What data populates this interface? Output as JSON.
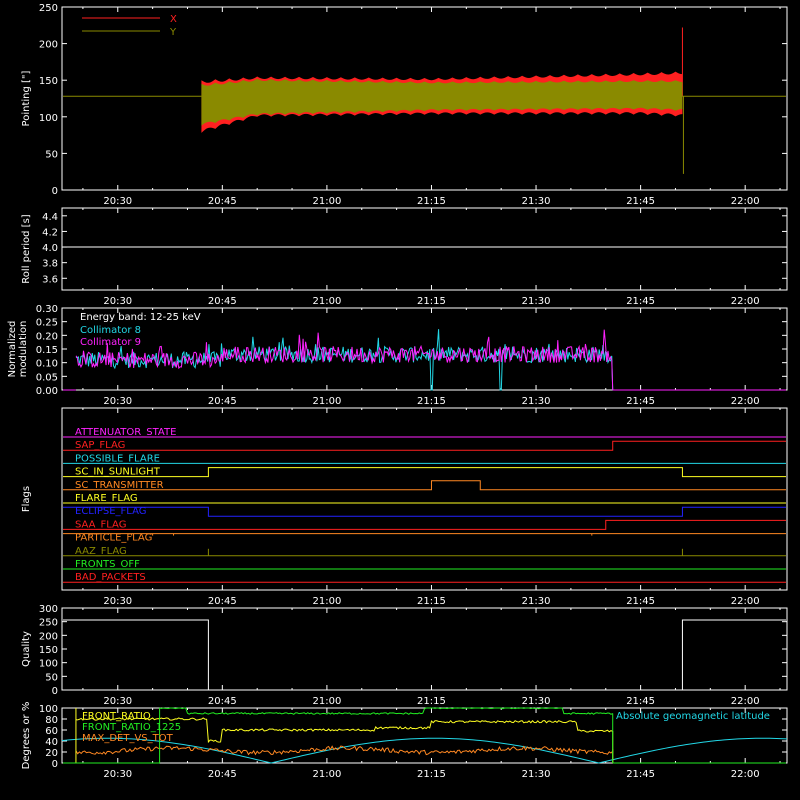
{
  "time_axis": {
    "start": "20:22",
    "end": "22:06",
    "ticks": [
      "20:30",
      "20:45",
      "21:00",
      "21:15",
      "21:30",
      "21:45",
      "22:00"
    ]
  },
  "colors": {
    "axis": "#ffffff",
    "x": "#ff2020",
    "y": "#8a8a00",
    "white": "#ffffff",
    "cyan": "#22d7e6",
    "magenta": "#ff22ff",
    "green": "#22ee22",
    "yellow": "#ffff22",
    "orange": "#ff8822"
  },
  "chart_data": [
    {
      "id": "pointing",
      "type": "line",
      "ylabel": "Pointing [\"]",
      "ylim": [
        0,
        250
      ],
      "yticks": [
        0,
        50,
        100,
        150,
        200,
        250
      ],
      "legend": {
        "position": "top-left",
        "entries": [
          {
            "label": "X",
            "color": "#ff2020"
          },
          {
            "label": "Y",
            "color": "#8a8a00"
          }
        ]
      },
      "series": [
        {
          "name": "X",
          "baseline": 128,
          "active_start": "20:42",
          "active_end": "21:51",
          "band": [
            {
              "x": "20:42",
              "low": 78,
              "high": 150
            },
            {
              "x": "20:50",
              "low": 100,
              "high": 155
            },
            {
              "x": "21:15",
              "low": 103,
              "high": 153
            },
            {
              "x": "21:45",
              "low": 103,
              "high": 160
            },
            {
              "x": "21:51",
              "low": 100,
              "high": 162
            }
          ]
        },
        {
          "name": "Y",
          "baseline": 128,
          "active_start": "20:42",
          "active_end": "21:51",
          "band": [
            {
              "x": "20:42",
              "low": 88,
              "high": 145
            },
            {
              "x": "20:50",
              "low": 102,
              "high": 152
            },
            {
              "x": "21:15",
              "low": 108,
              "high": 148
            },
            {
              "x": "21:45",
              "low": 110,
              "high": 150
            },
            {
              "x": "21:51",
              "low": 108,
              "high": 150
            }
          ]
        }
      ],
      "spike": {
        "x": "21:51",
        "high": 222,
        "low": 22
      }
    },
    {
      "id": "roll",
      "type": "line",
      "ylabel": "Roll period [s]",
      "ylim": [
        3.45,
        4.5
      ],
      "yticks": [
        3.6,
        3.8,
        4.0,
        4.2,
        4.4
      ],
      "yticklabels": [
        "3.6",
        "3.8",
        "4.0",
        "4.2",
        "4.4"
      ],
      "series": [
        {
          "name": "",
          "values": [
            {
              "x": "20:22",
              "y": 4.0
            },
            {
              "x": "22:06",
              "y": 4.0
            }
          ]
        }
      ]
    },
    {
      "id": "modulation",
      "type": "line",
      "ylabel": "Normalized\nmodulation",
      "ylim": [
        0,
        0.3
      ],
      "yticks": [
        0,
        0.05,
        0.1,
        0.15,
        0.2,
        0.25,
        0.3
      ],
      "yticklabels": [
        "0.00",
        "0.05",
        "0.10",
        "0.15",
        "0.20",
        "0.25",
        "0.30"
      ],
      "annotation": "Energy band: 12-25 keV",
      "series": [
        {
          "name": "Collimator 8",
          "active_start": "20:24",
          "active_end": "21:41",
          "level_before_2045": 0.11,
          "level_after_2045": 0.13,
          "drops_to_zero": [
            "21:15",
            "21:25"
          ]
        },
        {
          "name": "Collimator 9",
          "active_start": "20:24",
          "active_end": "21:41",
          "level_before_2045": 0.11,
          "level_after_2045": 0.13
        }
      ]
    },
    {
      "id": "flags",
      "type": "line",
      "ylabel": "Flags",
      "series": [
        {
          "name": "ATTENUATOR_STATE",
          "color": "#ff22ff",
          "steps": []
        },
        {
          "name": "SAP_FLAG",
          "color": "#ff2020",
          "steps": [
            {
              "x": "21:41",
              "v": 1
            }
          ]
        },
        {
          "name": "POSSIBLE_FLARE",
          "color": "#22d7e6",
          "steps": []
        },
        {
          "name": "SC_IN_SUNLIGHT",
          "color": "#ffff22",
          "steps": [
            {
              "x": "20:43",
              "v": 1
            },
            {
              "x": "21:51",
              "v": 0
            }
          ]
        },
        {
          "name": "SC_TRANSMITTER",
          "color": "#ff8822",
          "steps": [
            {
              "x": "21:15",
              "v": 1
            },
            {
              "x": "21:22",
              "v": 0
            }
          ]
        },
        {
          "name": "FLARE_FLAG",
          "color": "#ffff22",
          "steps": []
        },
        {
          "name": "ECLIPSE_FLAG",
          "color": "#2222ff",
          "steps": [
            {
              "x": "20:43",
              "v": 0
            },
            {
              "x": "21:51",
              "v": 1
            }
          ],
          "initial": 1
        },
        {
          "name": "SAA_FLAG",
          "color": "#ff2020",
          "steps": [
            {
              "x": "21:40",
              "v": 1
            }
          ]
        },
        {
          "name": "PARTICLE_FLAG",
          "color": "#ff8822",
          "steps": [
            {
              "x": "20:43",
              "v": 1
            }
          ],
          "initial": 1,
          "spikes": [
            "20:26",
            "20:29",
            "20:32",
            "20:35",
            "20:38",
            "21:38"
          ]
        },
        {
          "name": "AAZ_FLAG",
          "color": "#8a8a00",
          "steps": [],
          "spikes": [
            "20:43",
            "21:51"
          ]
        },
        {
          "name": "FRONTS_OFF",
          "color": "#22ee22",
          "steps": []
        },
        {
          "name": "BAD_PACKETS",
          "color": "#ff2020",
          "steps": []
        }
      ]
    },
    {
      "id": "quality",
      "type": "line",
      "ylabel": "Quality",
      "ylim": [
        0,
        300
      ],
      "yticks": [
        0,
        50,
        100,
        150,
        200,
        250,
        300
      ],
      "series": [
        {
          "name": "",
          "values": [
            {
              "x": "20:22",
              "y": 256
            },
            {
              "x": "20:43",
              "y": 256
            },
            {
              "x": "20:43",
              "y": 0
            },
            {
              "x": "21:51",
              "y": 0
            },
            {
              "x": "21:51",
              "y": 256
            },
            {
              "x": "22:06",
              "y": 256
            }
          ]
        }
      ]
    },
    {
      "id": "geo",
      "type": "line",
      "ylabel": "Degrees or %",
      "ylim": [
        0,
        100
      ],
      "yticks": [
        0,
        20,
        40,
        60,
        80,
        100
      ],
      "annotation": "Absolute geomagnetic latitude",
      "series": [
        {
          "name": "FRONT_RATIO",
          "color": "#ffff22"
        },
        {
          "name": "FRONT_RATIO_1225",
          "color": "#22ee22"
        },
        {
          "name": "MAX_DET_VS_TOT",
          "color": "#ff8822"
        },
        {
          "name": "Absolute geomagnetic latitude",
          "color": "#22d7e6"
        }
      ]
    }
  ]
}
